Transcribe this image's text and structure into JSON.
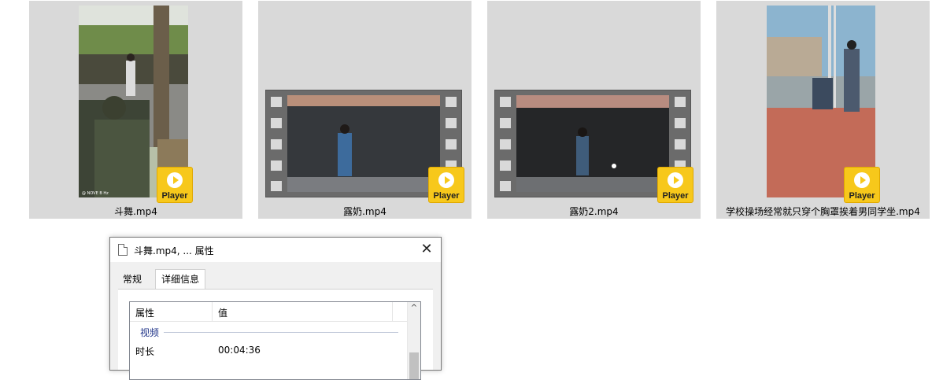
{
  "files": [
    {
      "name": "斗舞.mp4",
      "player_label": "Player",
      "thumb_overlay": "@ NOVE B Hz"
    },
    {
      "name": "露奶.mp4",
      "player_label": "Player"
    },
    {
      "name": "露奶2.mp4",
      "player_label": "Player"
    },
    {
      "name": "学校操场经常就只穿个胸罩挨着男同学坐.mp4",
      "player_label": "Player"
    }
  ],
  "dialog": {
    "title": "斗舞.mp4, ... 属性",
    "close_glyph": "✕",
    "tabs": [
      {
        "label": "常规",
        "active": false
      },
      {
        "label": "详细信息",
        "active": true
      }
    ],
    "table": {
      "col_property": "属性",
      "col_value": "值",
      "group": "视频",
      "rows": [
        {
          "key": "时长",
          "value": "00:04:36"
        }
      ],
      "scroll_up_glyph": "^"
    }
  },
  "colors": {
    "tile_bg": "#d9d9d9",
    "player_badge": "#f7c81b",
    "film_strip": "#6b6b6b",
    "group_text": "#1e3287"
  },
  "icons": [
    "play-icon",
    "document-icon",
    "close-icon",
    "scroll-up-icon"
  ]
}
